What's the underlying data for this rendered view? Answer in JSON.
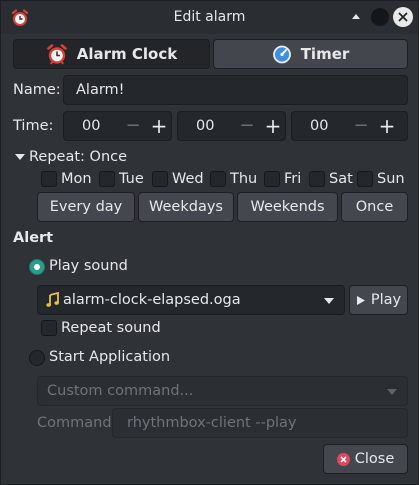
{
  "window": {
    "title": "Edit alarm"
  },
  "tabs": [
    {
      "label": "Alarm Clock",
      "icon": "alarm-clock-icon"
    },
    {
      "label": "Timer",
      "icon": "stopwatch-icon"
    }
  ],
  "name": {
    "label": "Name:",
    "value": "Alarm!"
  },
  "time": {
    "label": "Time:",
    "hours": "00",
    "minutes": "00",
    "seconds": "00",
    "minus": "−",
    "plus": "+"
  },
  "repeat": {
    "label": "Repeat: Once",
    "days": [
      "Mon",
      "Tue",
      "Wed",
      "Thu",
      "Fri",
      "Sat",
      "Sun"
    ],
    "presets": [
      "Every day",
      "Weekdays",
      "Weekends",
      "Once"
    ]
  },
  "alert": {
    "heading": "Alert",
    "play_sound_label": "Play sound",
    "sound_file": "alarm-clock-elapsed.oga",
    "play_button": "Play",
    "repeat_sound_label": "Repeat sound",
    "start_app_label": "Start Application",
    "custom_command_placeholder": "Custom command...",
    "command_label": "Command:",
    "command_value": "rhythmbox-client --play"
  },
  "close_button": "Close",
  "colors": {
    "accent": "#2a9d8f",
    "close_icon": "#e0485a",
    "music_icon": "#e8c14d"
  }
}
